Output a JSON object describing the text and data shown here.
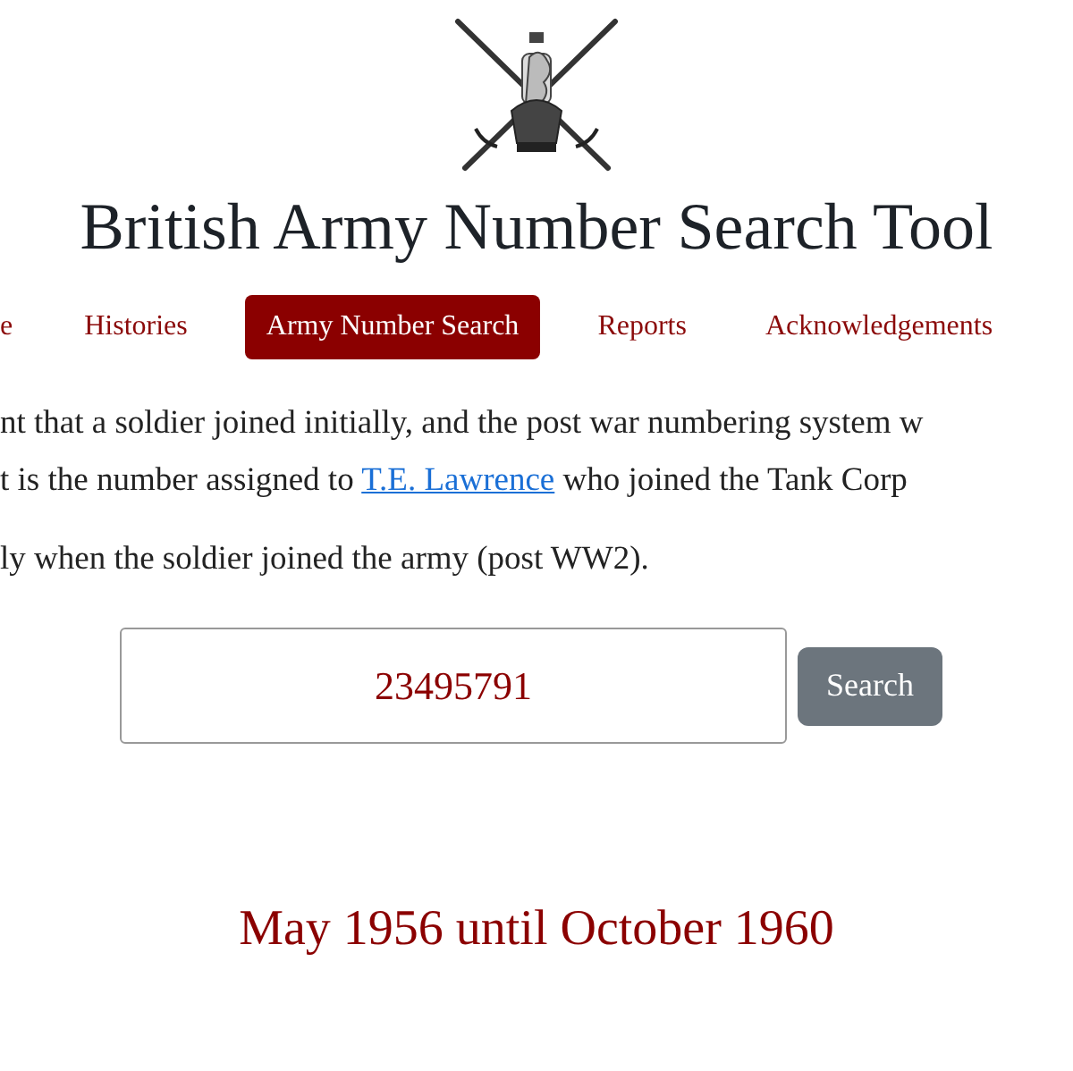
{
  "title": "British Army Number Search Tool",
  "nav": [
    {
      "label": "e",
      "selected": false
    },
    {
      "label": "Histories",
      "selected": false
    },
    {
      "label": "Army Number Search",
      "selected": true
    },
    {
      "label": "Reports",
      "selected": false
    },
    {
      "label": "Acknowledgements",
      "selected": false
    }
  ],
  "paragraphs": [
    {
      "lines": [
        {
          "before": "nt that a soldier joined initially, and the post war numbering system w"
        },
        {
          "before": "t is the number assigned to ",
          "link": "T.E. Lawrence",
          "after": " who joined the Tank Corp"
        }
      ]
    },
    {
      "lines": [
        {
          "before": "ly when the soldier joined the army (post WW2)."
        }
      ]
    }
  ],
  "search": {
    "value": "23495791",
    "button": "Search"
  },
  "result": "May 1956 until October 1960"
}
